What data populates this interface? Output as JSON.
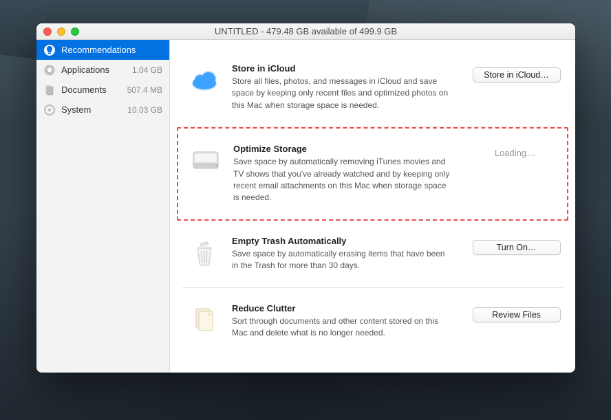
{
  "window": {
    "title": "UNTITLED - 479.48 GB available of 499.9 GB"
  },
  "sidebar": {
    "items": [
      {
        "label": "Recommendations",
        "size": "",
        "icon": "lightbulb-icon",
        "selected": true
      },
      {
        "label": "Applications",
        "size": "1.04 GB",
        "icon": "applications-icon",
        "selected": false
      },
      {
        "label": "Documents",
        "size": "507.4 MB",
        "icon": "documents-icon",
        "selected": false
      },
      {
        "label": "System",
        "size": "10.03 GB",
        "icon": "system-icon",
        "selected": false
      }
    ]
  },
  "recommendations": [
    {
      "icon": "cloud-icon",
      "title": "Store in iCloud",
      "description": "Store all files, photos, and messages in iCloud and save space by keeping only recent files and optimized photos on this Mac when storage space is needed.",
      "action_type": "button",
      "action_label": "Store in iCloud…",
      "highlighted": false
    },
    {
      "icon": "drive-icon",
      "title": "Optimize Storage",
      "description": "Save space by automatically removing iTunes movies and TV shows that you've already watched and by keeping only recent email attachments on this Mac when storage space is needed.",
      "action_type": "loading",
      "action_label": "Loading…",
      "highlighted": true
    },
    {
      "icon": "trash-icon",
      "title": "Empty Trash Automatically",
      "description": "Save space by automatically erasing items that have been in the Trash for more than 30 days.",
      "action_type": "button",
      "action_label": "Turn On…",
      "highlighted": false
    },
    {
      "icon": "files-icon",
      "title": "Reduce Clutter",
      "description": "Sort through documents and other content stored on this Mac and delete what is no longer needed.",
      "action_type": "button",
      "action_label": "Review Files",
      "highlighted": false
    }
  ]
}
